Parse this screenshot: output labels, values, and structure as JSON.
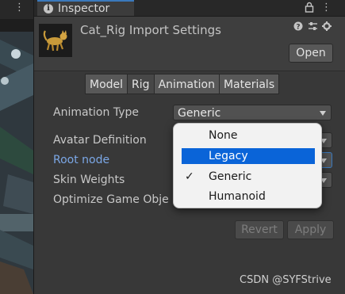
{
  "inspector": {
    "tab_label": "Inspector",
    "title": "Cat_Rig Import Settings",
    "open_label": "Open",
    "tabs": [
      "Model",
      "Rig",
      "Animation",
      "Materials"
    ],
    "active_tab": "Rig"
  },
  "rig": {
    "animation_type_label": "Animation Type",
    "animation_type_value": "Generic",
    "avatar_definition_label": "Avatar Definition",
    "root_node_label": "Root node",
    "skin_weights_label": "Skin Weights",
    "optimize_label": "Optimize Game Obje"
  },
  "dropdown_menu": {
    "options": [
      {
        "label": "None",
        "checked": false,
        "highlighted": false
      },
      {
        "label": "Legacy",
        "checked": false,
        "highlighted": true
      },
      {
        "label": "Generic",
        "checked": true,
        "highlighted": false
      },
      {
        "label": "Humanoid",
        "checked": false,
        "highlighted": false
      }
    ],
    "checkmark": "✓"
  },
  "footer": {
    "revert_label": "Revert",
    "apply_label": "Apply"
  },
  "watermark": "CSDN @SYFStrive",
  "icons": {
    "lock": "lock-icon",
    "more": "more-vert-icon",
    "help": "help-icon",
    "presets": "presets-icon",
    "gear": "gear-icon"
  },
  "colors": {
    "accent": "#3a79bb",
    "highlight": "#0a64d8",
    "root_label": "#7ba7e6",
    "panel": "#383838"
  }
}
